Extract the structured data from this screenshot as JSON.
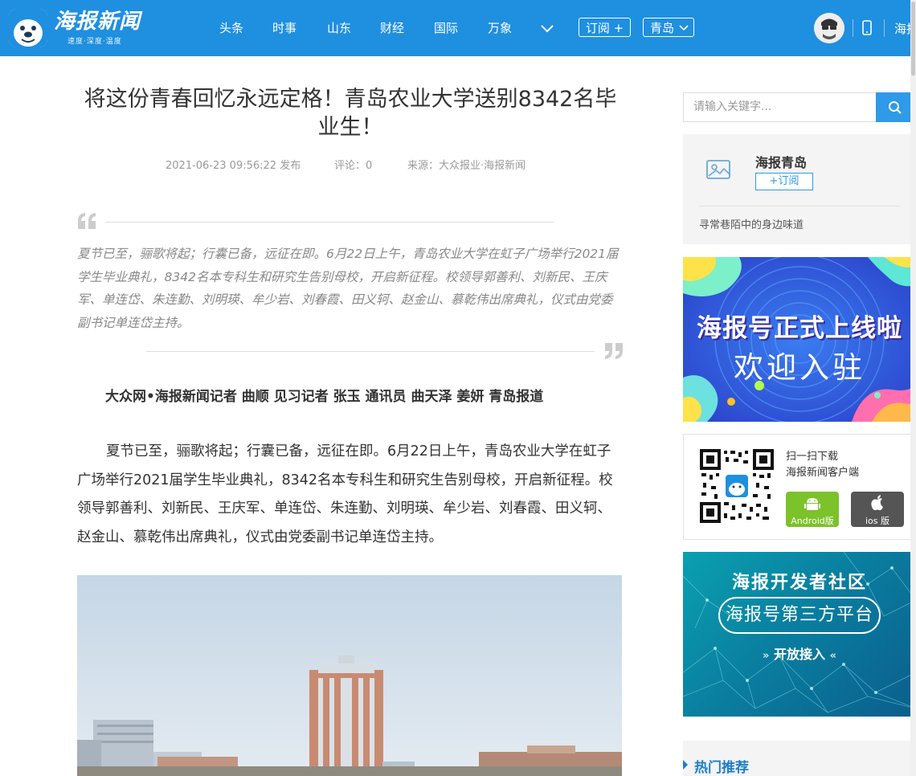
{
  "header": {
    "logo_text": "海报新闻",
    "logo_tagline": "速度·深度·温度",
    "nav": [
      "头条",
      "时事",
      "山东",
      "财经",
      "国际",
      "万象"
    ],
    "subscribe_label": "订阅 +",
    "city_label": "青岛",
    "right_text": "海报",
    "brand_color": "#1f8fe0"
  },
  "article": {
    "title": "将这份青春回忆永远定格！青岛农业大学送别8342名毕业生！",
    "meta": {
      "published": "2021-06-23 09:56:22 发布",
      "comments": "评论：0",
      "source": "来源：大众报业·海报新闻"
    },
    "summary": "夏节已至，骊歌将起；行囊已备，远征在即。6月22日上午，青岛农业大学在虹子广场举行2021届学生毕业典礼，8342名本专科生和研究生告别母校，开启新征程。校领导郭善利、刘新民、王庆军、单连岱、朱连勤、刘明瑛、牟少岩、刘春霞、田义轲、赵金山、慕乾伟出席典礼，仪式由党委副书记单连岱主持。",
    "byline": "大众网•海报新闻记者 曲顺 见习记者 张玉 通讯员 曲天泽 姜妍 青岛报道",
    "body": "夏节已至，骊歌将起；行囊已备，远征在即。6月22日上午，青岛农业大学在虹子广场举行2021届学生毕业典礼，8342名本专科生和研究生告别母校，开启新征程。校领导郭善利、刘新民、王庆军、单连岱、朱连勤、刘明瑛、牟少岩、刘春霞、田义轲、赵金山、慕乾伟出席典礼，仪式由党委副书记单连岱主持。"
  },
  "sidebar": {
    "search_placeholder": "请输入关键字...",
    "account": {
      "name": "海报青岛",
      "subscribe_label": "+订阅",
      "description": "寻常巷陌中的身边味道"
    },
    "banner1": {
      "line1": "海报号正式上线啦",
      "line2": "欢迎入驻"
    },
    "download": {
      "line1": "扫一扫下载",
      "line2": "海报新闻客户端",
      "android_label": "Android版",
      "ios_label": "ios 版",
      "android_color": "#7cc22a",
      "ios_color": "#555555"
    },
    "banner2": {
      "title": "海报开发者社区",
      "pill": "海报号第三方平台",
      "cta": "开放接入"
    },
    "hot_label": "热门推荐"
  }
}
